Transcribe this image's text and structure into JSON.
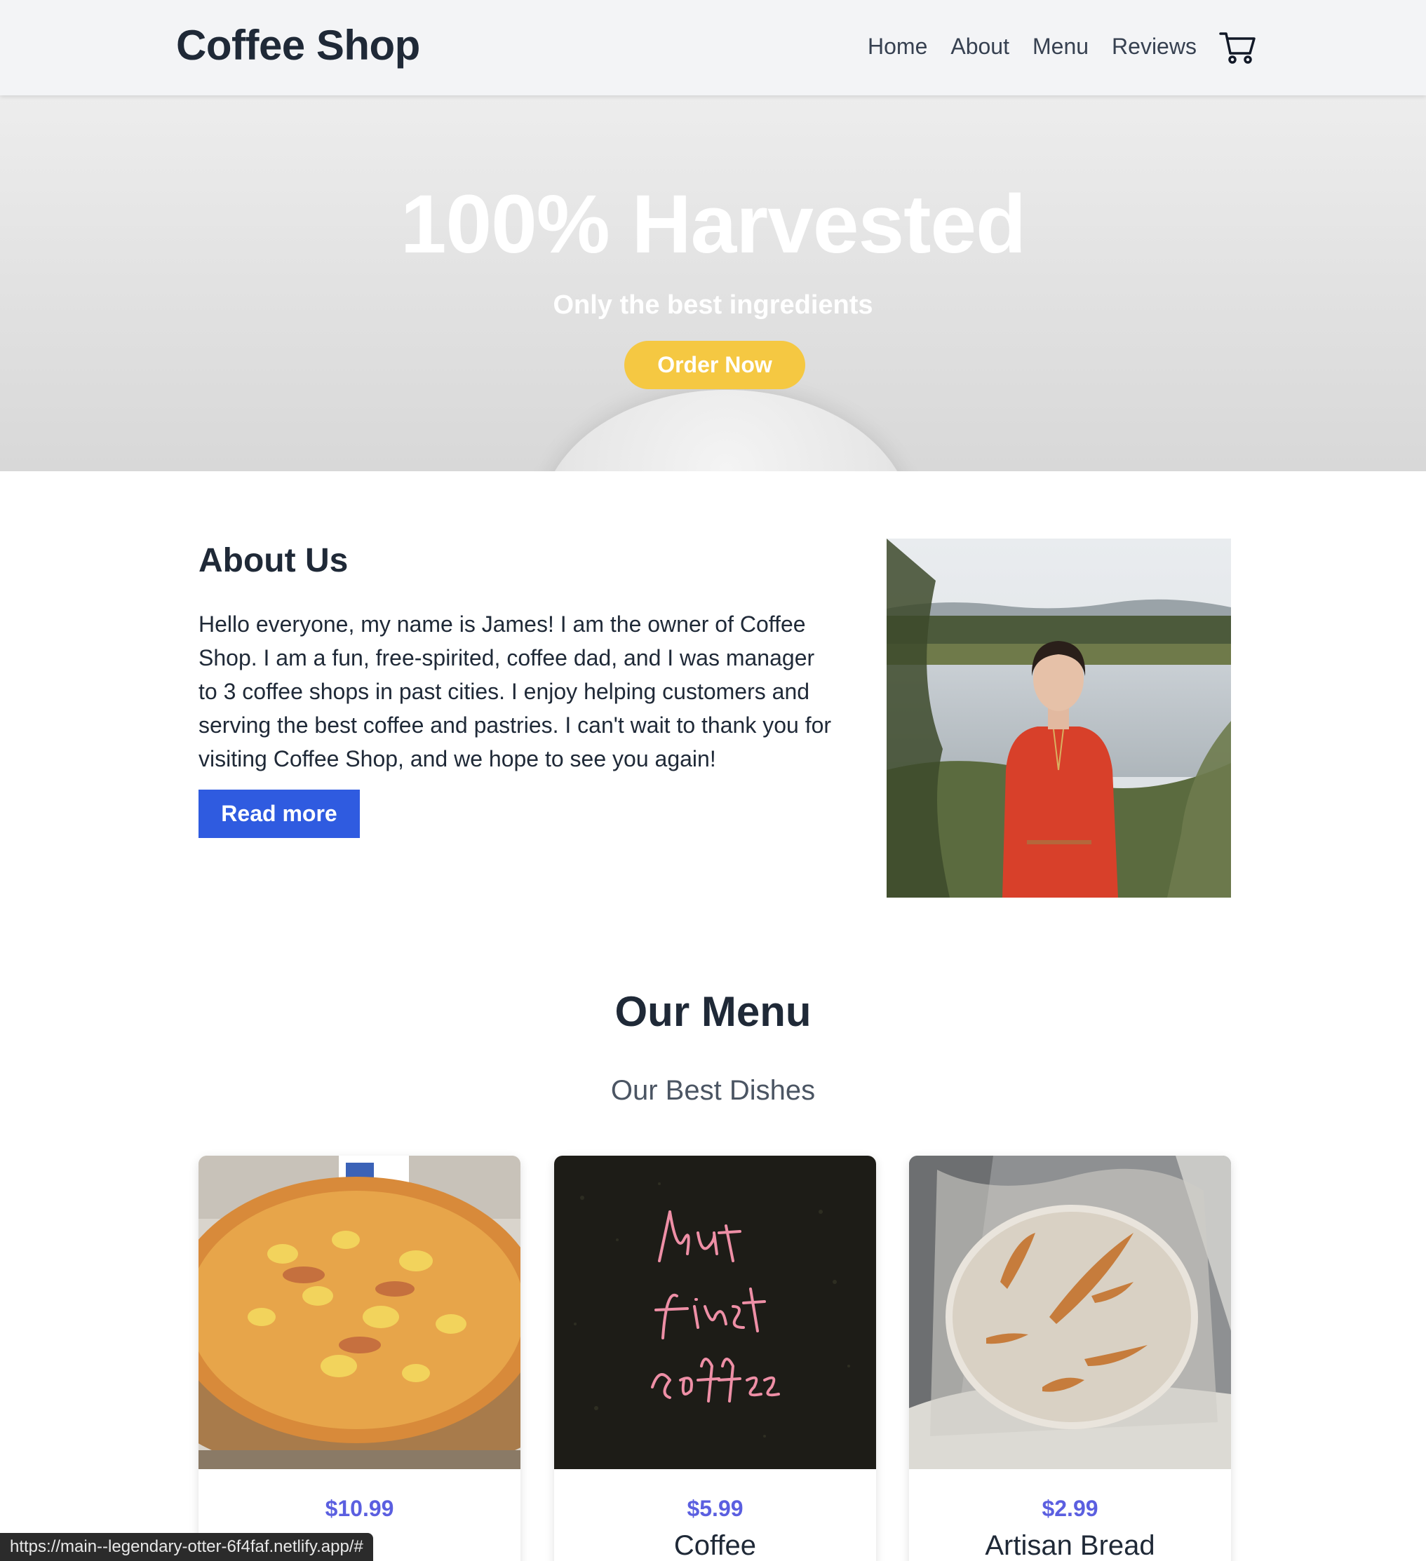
{
  "navbar": {
    "brand": "Coffee Shop",
    "links": [
      "Home",
      "About",
      "Menu",
      "Reviews"
    ],
    "cart_icon": "shopping-cart-icon"
  },
  "hero": {
    "title": "100% Harvested",
    "subtitle": "Only the best ingredients",
    "button": "Order Now",
    "button_color": "#f5c842"
  },
  "about": {
    "title": "About Us",
    "text": "Hello everyone, my name is James! I am the owner of Coffee Shop. I am a fun, free-spirited, coffee dad, and I was manager to 3 coffee shops in past cities. I enjoy helping customers and serving the best coffee and pastries. I can't wait to thank you for visiting Coffee Shop, and we hope to see you again!",
    "button": "Read more",
    "button_color": "#2f5be0"
  },
  "menu": {
    "title": "Our Menu",
    "subtitle": "Our Best Dishes",
    "price_color": "#5b5fe0",
    "items": [
      {
        "price": "$10.99",
        "name": ""
      },
      {
        "price": "$5.99",
        "name": "Coffee"
      },
      {
        "price": "$2.99",
        "name": "Artisan Bread"
      }
    ]
  },
  "status_bar": {
    "url": "https://main--legendary-otter-6f4faf.netlify.app/#"
  }
}
